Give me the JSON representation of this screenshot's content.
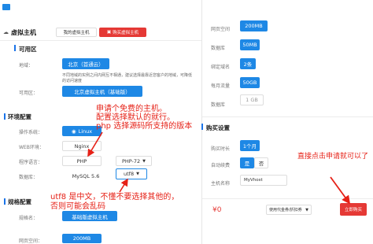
{
  "header": {
    "title": "虚拟主机",
    "my_hosts_btn": "我的虚拟主机",
    "buy_hosts_btn": "购买虚拟主机"
  },
  "availability": {
    "section_title": "可用区",
    "region_label": "地域：",
    "region_value": "北京（首通云）",
    "region_note_1": "不同地域的实例之间内网互不相通，建议选择最靠近您客户的地域，可降低",
    "region_note_2": "的访问速度",
    "zone_label": "可用区：",
    "zone_value": "北京虚拟主机（基础版）"
  },
  "environment": {
    "section_title": "环境配置",
    "os_label": "操作系统：",
    "os_value": "Linux",
    "web_label": "WEB环境：",
    "web_value": "Nginx",
    "lang_label": "程序语言：",
    "lang_value": "PHP",
    "lang_version": "PHP-72",
    "db_label": "数据库：",
    "db_value": "MySQL 5.6",
    "charset_value": "utf8"
  },
  "spec": {
    "section_title": "规格配置",
    "spec_label": "规格名：",
    "spec_value": "基础版虚拟主机",
    "space_label": "网页空间：",
    "space_value": "200MB"
  },
  "right_specs": {
    "web_space_label": "网页空间",
    "web_space_value": "200MB",
    "db_label": "数据库",
    "db_value": "50MB",
    "domain_label": "绑定域名",
    "domain_value": "2条",
    "traffic_label": "每月流量",
    "traffic_value": "50GB",
    "data_label": "数据库",
    "data_value": "1 GB"
  },
  "purchase": {
    "section_title": "购买设置",
    "duration_label": "购买时长",
    "duration_value": "1个月",
    "auto_renew_label": "自动续费",
    "auto_yes": "是",
    "auto_no": "否",
    "host_name_label": "主机名称",
    "host_name_value": "MyVhost",
    "price": "¥0",
    "coupon_value": "使用代金券/折扣券",
    "buy_button": "立即购买"
  },
  "annotations": {
    "note_free_1": "申请个免费的主机。",
    "note_free_2": "配置选择默认的就行。",
    "note_free_3": "php 选择源码所支持的版本",
    "note_utf8_1": "utf8 是中文，不懂不要选择其他的，",
    "note_utf8_2": "否则可能会乱码",
    "note_buy": "直接点击申请就可以了"
  },
  "colors": {
    "accent": "#1e88e5",
    "danger": "#e53935",
    "annotation": "#e62117"
  }
}
